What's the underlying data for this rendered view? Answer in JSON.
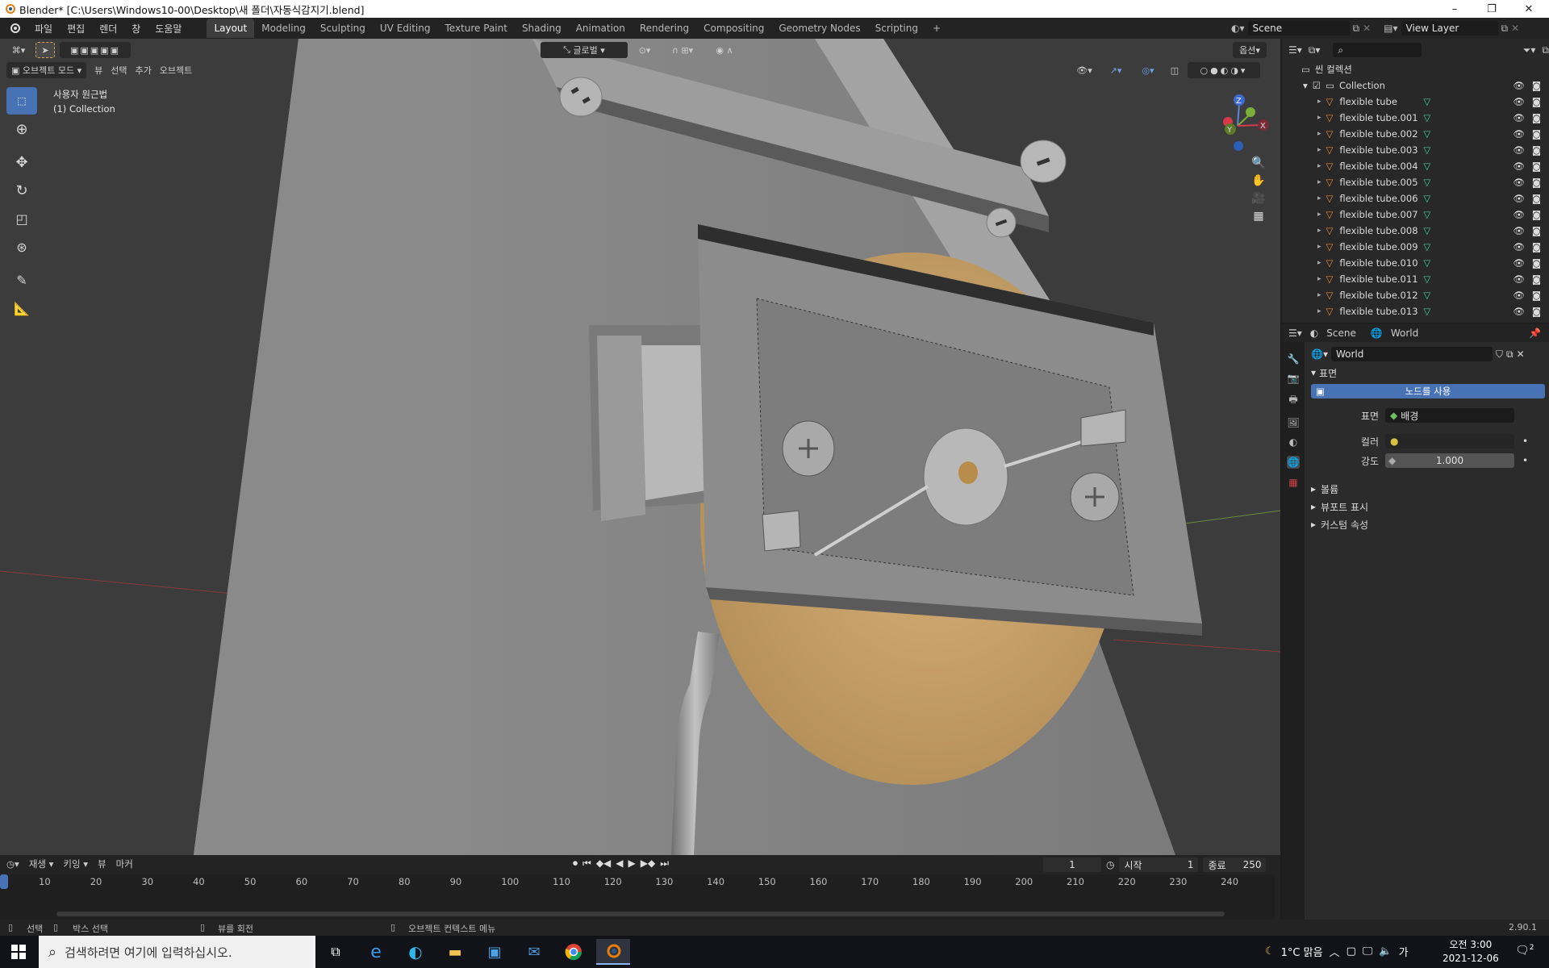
{
  "window": {
    "title": "Blender* [C:\\Users\\Windows10-00\\Desktop\\새 폴더\\자동식감지기.blend]",
    "minimize": "–",
    "maximize": "❐",
    "close": "✕"
  },
  "menu": [
    "파일",
    "편집",
    "렌더",
    "창",
    "도움말"
  ],
  "workspaces": [
    "Layout",
    "Modeling",
    "Sculpting",
    "UV Editing",
    "Texture Paint",
    "Shading",
    "Animation",
    "Rendering",
    "Compositing",
    "Geometry Nodes",
    "Scripting"
  ],
  "active_workspace": "Layout",
  "add_tab": "+",
  "scene": {
    "name": "Scene",
    "view_layer": "View Layer"
  },
  "viewport": {
    "mode": "오브젝트 모드",
    "menus": [
      "뷰",
      "선택",
      "추가",
      "오브젝트"
    ],
    "transform_orientation": "글로벌",
    "options": "옵션",
    "view_name": "사용자 원근법",
    "collection_info": "(1) Collection",
    "gizmo": {
      "z": "Z",
      "y": "Y",
      "x": "X"
    }
  },
  "outliner": {
    "root": "씬 컬렉션",
    "collection": "Collection",
    "items": [
      "flexible tube",
      "flexible tube.001",
      "flexible tube.002",
      "flexible tube.003",
      "flexible tube.004",
      "flexible tube.005",
      "flexible tube.006",
      "flexible tube.007",
      "flexible tube.008",
      "flexible tube.009",
      "flexible tube.010",
      "flexible tube.011",
      "flexible tube.012",
      "flexible tube.013"
    ]
  },
  "properties": {
    "breadcrumb_scene": "Scene",
    "breadcrumb_world": "World",
    "world_name": "World",
    "surface_panel": "표면",
    "use_nodes": "노드를 사용",
    "surface_label": "표면",
    "surface_value": "배경",
    "color_label": "컬러",
    "strength_label": "강도",
    "strength_value": "1.000",
    "panels": [
      "볼륨",
      "뷰포트 표시",
      "커스텀 속성"
    ]
  },
  "timeline": {
    "menus": [
      "재생",
      "키잉",
      "뷰",
      "마커"
    ],
    "current_frame": "1",
    "start_label": "시작",
    "start": "1",
    "end_label": "종료",
    "end": "250",
    "ticks": [
      "10",
      "20",
      "30",
      "40",
      "50",
      "60",
      "70",
      "80",
      "90",
      "100",
      "110",
      "120",
      "130",
      "140",
      "150",
      "160",
      "170",
      "180",
      "190",
      "200",
      "210",
      "220",
      "230",
      "240"
    ]
  },
  "statusbar": {
    "select": "선택",
    "box_select": "박스 선택",
    "rotate_view": "뷰를 회전",
    "context_menu": "오브젝트 컨텍스트 메뉴",
    "version": "2.90.1"
  },
  "taskbar": {
    "search_placeholder": "검색하려면 여기에 입력하십시오.",
    "weather": "1°C 맑음",
    "ime": "가",
    "time": "오전 3:00",
    "date": "2021-12-06",
    "notifications": "2"
  },
  "colors": {
    "accent": "#4772b3",
    "disc": "#c9a46a",
    "object_orange": "#e08a3c",
    "mesh_green": "#3fd0a0"
  }
}
